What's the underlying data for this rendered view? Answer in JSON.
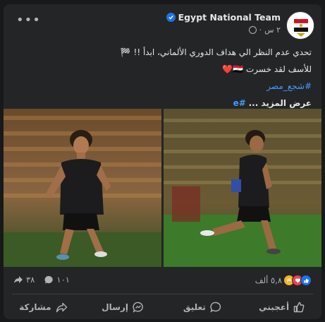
{
  "post": {
    "page_name": "Egypt National Team",
    "time": "٢ س",
    "privacy_icon": "globe-icon",
    "line1": "تحدي عدم النظر الي هداف الدوري الألماني، ابدأ !! 🏁",
    "line2": "للأسف لقد خسرت 🇪🇬❤️",
    "hashtag": "#شجع_مصر",
    "see_more": "عرض المزيد ...",
    "hashtag_trail": "#e"
  },
  "stats": {
    "reactions_count": "٥,٨ ألف",
    "comments_count": "١٠١",
    "shares_count": "٣٨",
    "reaction_colors": {
      "like": "#1b74e4",
      "love": "#f33e58",
      "care": "#f7b125"
    }
  },
  "actions": {
    "like": "أعجبني",
    "comment": "تعليق",
    "send": "إرسال",
    "share": "مشاركة"
  }
}
